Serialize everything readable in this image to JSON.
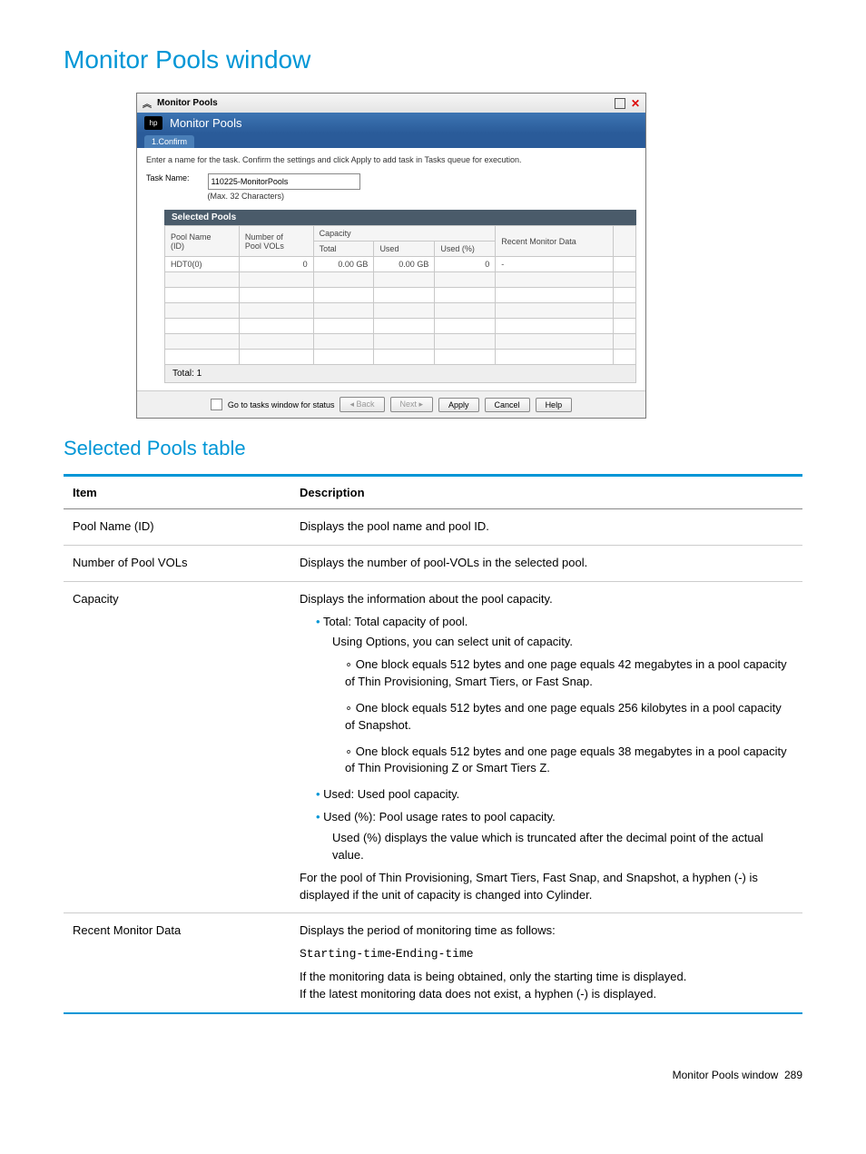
{
  "page": {
    "title": "Monitor Pools window",
    "section2_title": "Selected Pools table",
    "footer_label": "Monitor Pools window",
    "footer_page": "289"
  },
  "window": {
    "titlebar_text": "Monitor Pools",
    "header_text": "Monitor Pools",
    "tab_label": "1.Confirm",
    "instruction": "Enter a name for the task. Confirm the settings and click Apply to add task in Tasks queue for execution.",
    "task_name_label": "Task Name:",
    "task_name_value": "110225-MonitorPools",
    "max_note": "(Max. 32 Characters)",
    "selected_pools_header": "Selected Pools",
    "columns": {
      "pool_name_top": "Pool Name",
      "pool_name_sub": "(ID)",
      "num_vols_top": "Number of",
      "num_vols_sub": "Pool VOLs",
      "capacity": "Capacity",
      "total": "Total",
      "used": "Used",
      "used_pct": "Used (%)",
      "recent": "Recent Monitor Data"
    },
    "row": {
      "pool_name": "HDT0(0)",
      "num_vols": "0",
      "total": "0.00 GB",
      "used": "0.00 GB",
      "used_pct": "0",
      "recent": "-"
    },
    "table_footer": "Total: 1",
    "footer_checkbox_label": "Go to tasks window for status",
    "buttons": {
      "back": "◂ Back",
      "next": "Next ▸",
      "apply": "Apply",
      "cancel": "Cancel",
      "help": "Help"
    }
  },
  "desc_table": {
    "header_item": "Item",
    "header_desc": "Description",
    "rows": {
      "pool_name": {
        "item": "Pool Name (ID)",
        "desc": "Displays the pool name and pool ID."
      },
      "num_vols": {
        "item": "Number of Pool VOLs",
        "desc": "Displays the number of pool-VOLs in the selected pool."
      },
      "capacity": {
        "item": "Capacity",
        "intro": "Displays the information about the pool capacity.",
        "total_line": "Total: Total capacity of pool.",
        "total_sub": "Using Options, you can select unit of capacity.",
        "opt1": "One block equals 512 bytes and one page equals 42 megabytes in a pool capacity of Thin Provisioning, Smart Tiers, or Fast Snap.",
        "opt2": "One block equals 512 bytes and one page equals 256 kilobytes in a pool capacity of Snapshot.",
        "opt3": "One block equals 512 bytes and one page equals 38 megabytes in a pool capacity of Thin Provisioning Z or Smart Tiers Z.",
        "used_line": "Used: Used pool capacity.",
        "used_pct_line": "Used (%): Pool usage rates to pool capacity.",
        "used_pct_sub": "Used (%) displays the value which is truncated after the decimal point of the actual value.",
        "trailer": "For the pool of Thin Provisioning, Smart Tiers, Fast Snap, and Snapshot, a hyphen (-) is displayed if the unit of capacity is changed into Cylinder."
      },
      "recent": {
        "item": "Recent Monitor Data",
        "l1": "Displays the period of monitoring time as follows:",
        "l2a": "Starting-time",
        "l2b": "-",
        "l2c": "Ending-time",
        "l3": "If the monitoring data is being obtained, only the starting time is displayed.",
        "l4": "If the latest monitoring data does not exist, a hyphen (-) is displayed."
      }
    }
  }
}
